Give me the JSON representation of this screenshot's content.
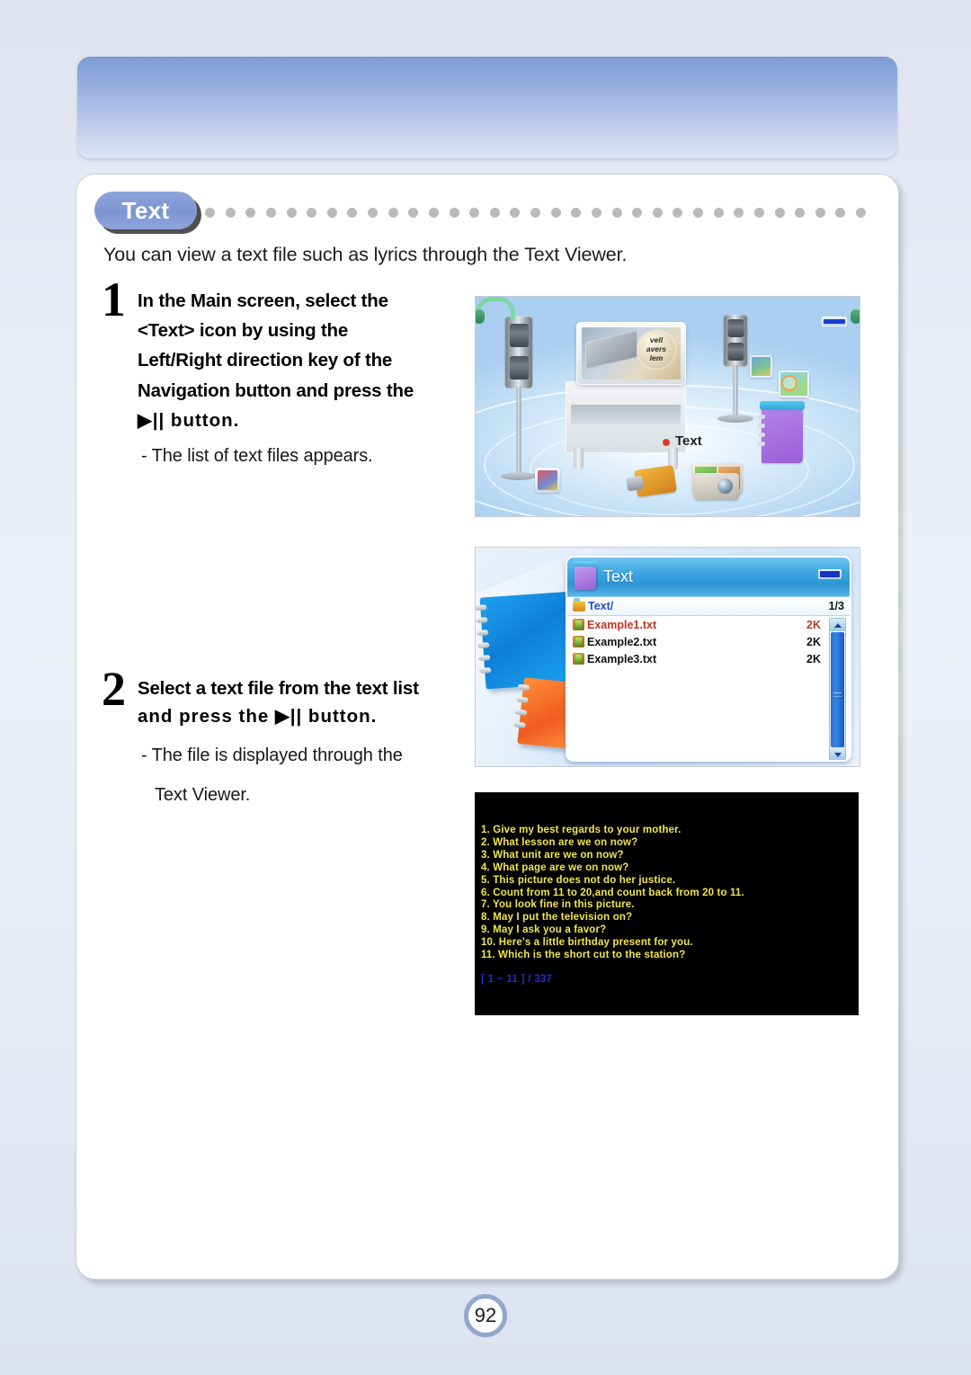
{
  "page": {
    "number": "92",
    "section_tab": "Text",
    "intro": "You can view a text file such as lyrics through the Text Viewer."
  },
  "steps": [
    {
      "number": "1",
      "title_lines": [
        "In the Main screen, select the",
        "<Text> icon by using the",
        "Left/Right direction key of the",
        "Navigation button and press the",
        "▶|| button."
      ],
      "notes": [
        "- The list of text files appears."
      ]
    },
    {
      "number": "2",
      "title_lines": [
        "Select a text file from the text list",
        "and press the  ▶|| button."
      ],
      "notes": [
        "- The file is displayed through the",
        "Text Viewer."
      ]
    }
  ],
  "main_screen": {
    "selected_label": "Text",
    "lens_text_lines": [
      "vell",
      "avers",
      "lem"
    ]
  },
  "file_list_screen": {
    "title": "Text",
    "path": "Text/",
    "page_indicator": "1/3",
    "files": [
      {
        "name": "Example1.txt",
        "size": "2K",
        "selected": true
      },
      {
        "name": "Example2.txt",
        "size": "2K",
        "selected": false
      },
      {
        "name": "Example3.txt",
        "size": "2K",
        "selected": false
      }
    ]
  },
  "text_viewer_screen": {
    "lines": [
      "1. Give my best regards to your mother.",
      "2. What lesson are we on now?",
      "3. What unit are we on now?",
      "4. What page are we on now?",
      "5. This picture does not do her justice.",
      "6. Count from 11 to 20,and count back from 20 to 11.",
      "7. You look fine in this picture.",
      "8. May I put the television on?",
      "9. May I ask you a favor?",
      "10. Here's a little birthday present for you.",
      "11. Which is the short cut to the station?"
    ],
    "status": "[ 1 ~ 11 ] / 337"
  },
  "colors": {
    "accent_blue": "#7e95d2",
    "banner_blue": "#7f9bd4",
    "selected_file_red": "#c0331f",
    "viewer_text_yellow": "#f2e54a",
    "viewer_status_blue": "#2032c6",
    "dot_gray": "#b9babd"
  }
}
